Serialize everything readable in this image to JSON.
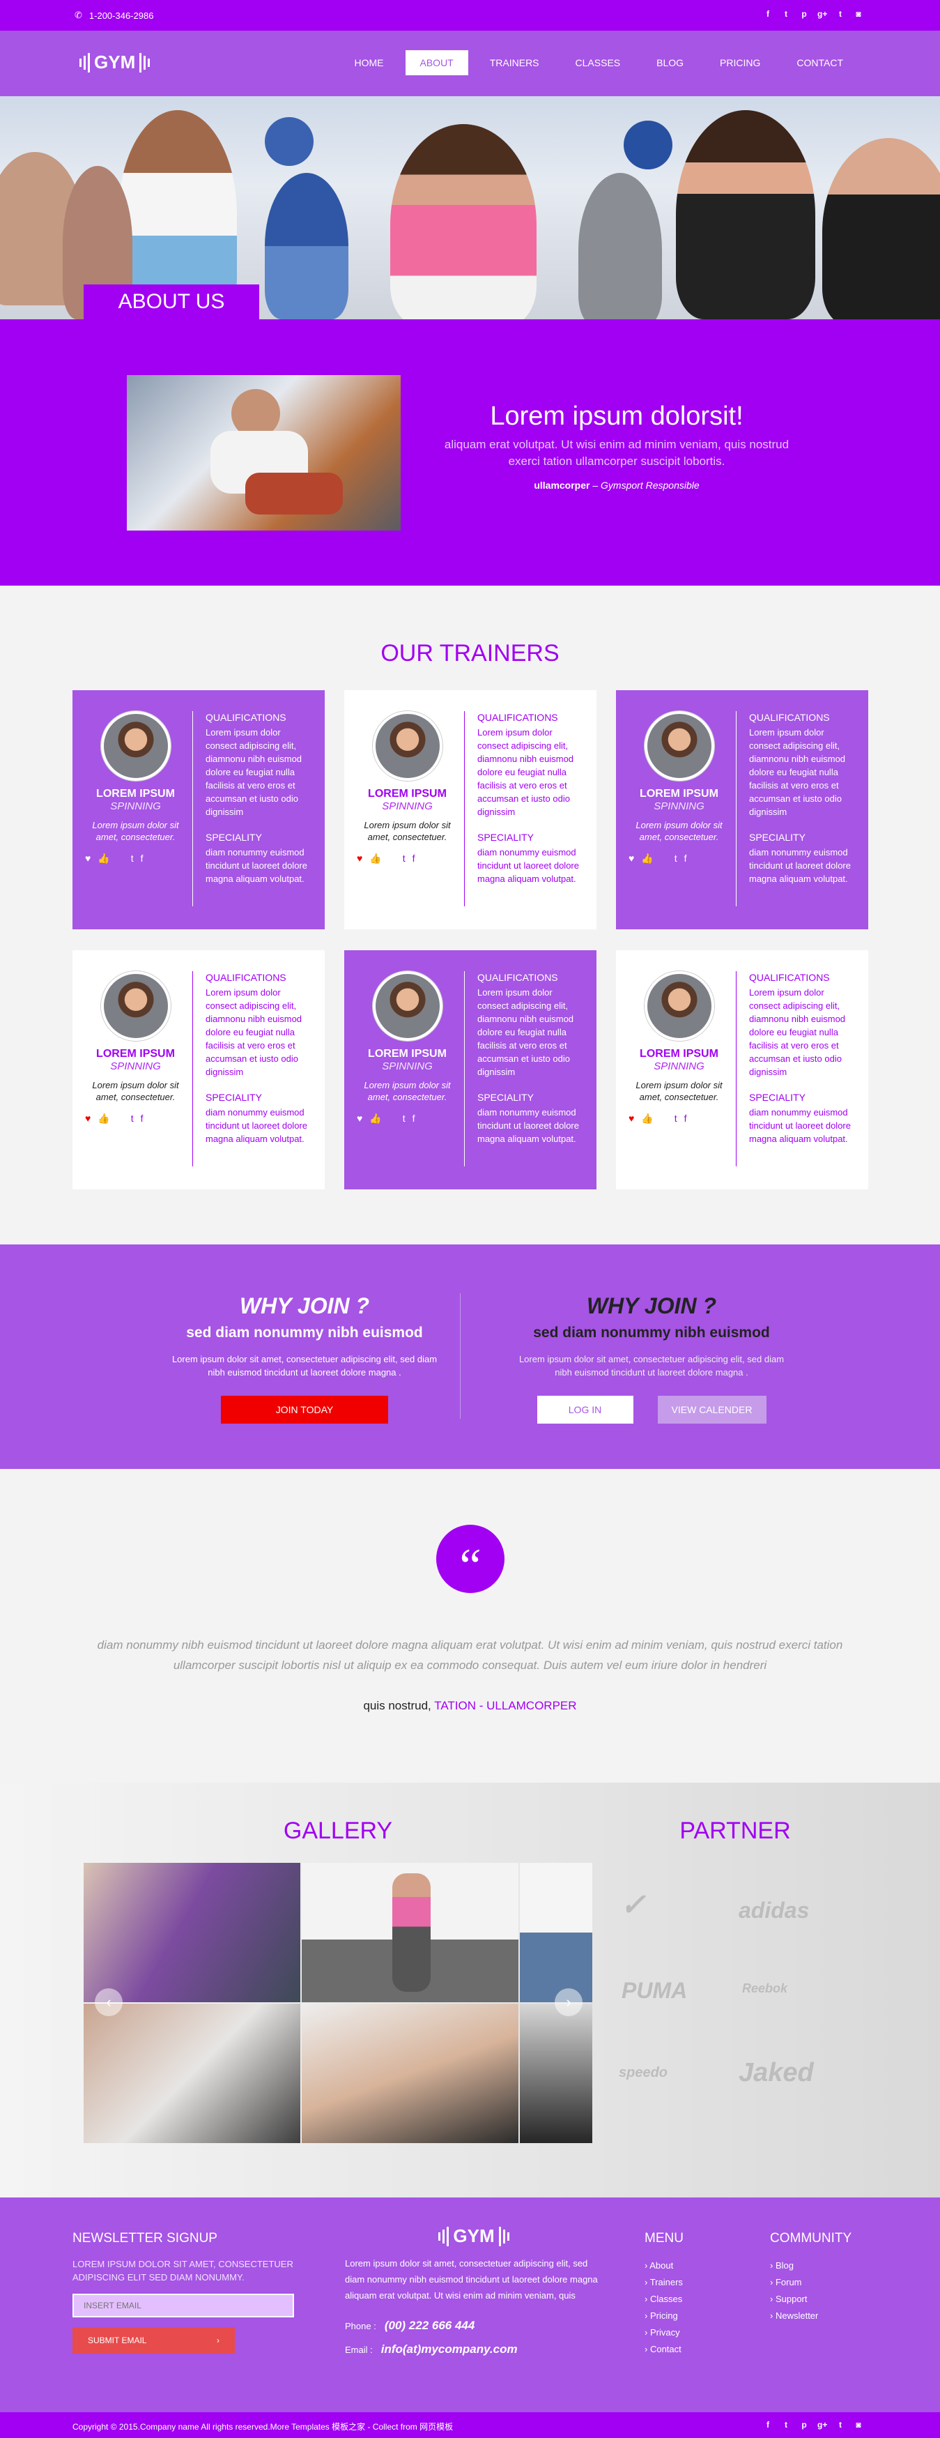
{
  "topbar": {
    "phone": "1-200-346-2986",
    "social_icons": [
      "facebook-icon",
      "twitter-icon",
      "pinterest-icon",
      "googleplus-icon",
      "tumblr-icon",
      "instagram-icon"
    ]
  },
  "brand": {
    "logo": "GYM"
  },
  "nav": {
    "items": [
      "HOME",
      "ABOUT",
      "TRAINERS",
      "CLASSES",
      "BLOG",
      "PRICING",
      "CONTACT"
    ],
    "active": "ABOUT"
  },
  "about": {
    "tab": "ABOUT US",
    "heading": "Lorem ipsum dolorsit!",
    "text": "aliquam erat volutpat. Ut wisi enim ad minim veniam, quis nostrud exerci tation ullamcorper suscipit lobortis.",
    "sig_name": "ullamcorper",
    "sig_role": "Gymsport Responsible"
  },
  "trainers": {
    "title": "OUR TRAINERS",
    "items": [
      {
        "name": "LOREM IPSUM",
        "role": "SPINNING",
        "desc": "Lorem ipsum dolor sit amet, consectetuer.",
        "qual_title": "QUALIFICATIONS",
        "qual": "Lorem ipsum dolor consect adipiscing elit, diamnonu nibh euismod dolore eu feugiat nulla facilisis at vero eros et accumsan et iusto odio dignissim",
        "spec_title": "SPECIALITY",
        "spec": "diam nonummy euismod tincidunt ut laoreet dolore magna aliquam volutpat."
      },
      {
        "name": "LOREM IPSUM",
        "role": "SPINNING",
        "desc": "Lorem ipsum dolor sit amet, consectetuer.",
        "qual_title": "QUALIFICATIONS",
        "qual": "Lorem ipsum dolor consect adipiscing elit, diamnonu nibh euismod dolore eu feugiat nulla facilisis at vero eros et accumsan et iusto odio dignissim",
        "spec_title": "SPECIALITY",
        "spec": "diam nonummy euismod tincidunt ut laoreet dolore magna aliquam volutpat."
      },
      {
        "name": "LOREM IPSUM",
        "role": "SPINNING",
        "desc": "Lorem ipsum dolor sit amet, consectetuer.",
        "qual_title": "QUALIFICATIONS",
        "qual": "Lorem ipsum dolor consect adipiscing elit, diamnonu nibh euismod dolore eu feugiat nulla facilisis at vero eros et accumsan et iusto odio dignissim",
        "spec_title": "SPECIALITY",
        "spec": "diam nonummy euismod tincidunt ut laoreet dolore magna aliquam volutpat."
      },
      {
        "name": "LOREM IPSUM",
        "role": "SPINNING",
        "desc": "Lorem ipsum dolor sit amet, consectetuer.",
        "qual_title": "QUALIFICATIONS",
        "qual": "Lorem ipsum dolor consect adipiscing elit, diamnonu nibh euismod dolore eu feugiat nulla facilisis at vero eros et accumsan et iusto odio dignissim",
        "spec_title": "SPECIALITY",
        "spec": "diam nonummy euismod tincidunt ut laoreet dolore magna aliquam volutpat."
      },
      {
        "name": "LOREM IPSUM",
        "role": "SPINNING",
        "desc": "Lorem ipsum dolor sit amet, consectetuer.",
        "qual_title": "QUALIFICATIONS",
        "qual": "Lorem ipsum dolor consect adipiscing elit, diamnonu nibh euismod dolore eu feugiat nulla facilisis at vero eros et accumsan et iusto odio dignissim",
        "spec_title": "SPECIALITY",
        "spec": "diam nonummy euismod tincidunt ut laoreet dolore magna aliquam volutpat."
      },
      {
        "name": "LOREM IPSUM",
        "role": "SPINNING",
        "desc": "Lorem ipsum dolor sit amet, consectetuer.",
        "qual_title": "QUALIFICATIONS",
        "qual": "Lorem ipsum dolor consect adipiscing elit, diamnonu nibh euismod dolore eu feugiat nulla facilisis at vero eros et accumsan et iusto odio dignissim",
        "spec_title": "SPECIALITY",
        "spec": "diam nonummy euismod tincidunt ut laoreet dolore magna aliquam volutpat."
      }
    ]
  },
  "why": {
    "left": {
      "title": "WHY JOIN ?",
      "sub": "sed diam nonummy nibh euismod",
      "text": "Lorem ipsum dolor sit amet, consectetuer adipiscing elit, sed diam nibh euismod tincidunt ut laoreet dolore magna .",
      "button": "JOIN TODAY"
    },
    "right": {
      "title": "WHY JOIN ?",
      "sub": "sed diam nonummy nibh euismod",
      "text": "Lorem ipsum dolor sit amet, consectetuer adipiscing elit, sed diam nibh euismod tincidunt ut laoreet dolore magna .",
      "login": "LOG IN",
      "calendar": "VIEW CALENDER"
    }
  },
  "quote": {
    "text": "diam nonummy nibh euismod tincidunt ut laoreet dolore magna aliquam erat volutpat. Ut wisi enim ad minim veniam, quis nostrud exerci tation ullamcorper suscipit lobortis nisl ut aliquip ex ea commodo consequat. Duis autem vel eum iriure dolor in hendreri",
    "by": "quis nostrud,",
    "author": "TATION - ULLAMCORPER"
  },
  "gallery": {
    "title": "GALLERY"
  },
  "partner": {
    "title": "PARTNER",
    "brands": [
      "adidas",
      "PUMA",
      "Reebok",
      "speedo",
      "Jaked"
    ]
  },
  "footer": {
    "newsletter_title": "NEWSLETTER SIGNUP",
    "newsletter_text": "LOREM IPSUM DOLOR SIT AMET, CONSECTETUER ADIPISCING ELIT SED DIAM NONUMMY.",
    "email_placeholder": "INSERT EMAIL",
    "submit": "SUBMIT EMAIL",
    "about_text": "Lorem ipsum dolor sit amet, consectetuer adipiscing elit, sed diam nonummy nibh euismod tincidunt ut laoreet dolore magna aliquam erat volutpat. Ut wisi enim ad minim veniam, quis",
    "phone_label": "Phone :",
    "phone": "(00) 222 666 444",
    "email_label": "Email :",
    "email": "info(at)mycompany.com",
    "menu_title": "MENU",
    "menu": [
      "About",
      "Trainers",
      "Classes",
      "Pricing",
      "Privacy",
      "Contact"
    ],
    "community_title": "COMMUNITY",
    "community": [
      "Blog",
      "Forum",
      "Support",
      "Newsletter"
    ]
  },
  "bottombar": {
    "copyright": "Copyright © 2015.Company name All rights reserved.More Templates 模板之家 - Collect from 网页模板"
  }
}
